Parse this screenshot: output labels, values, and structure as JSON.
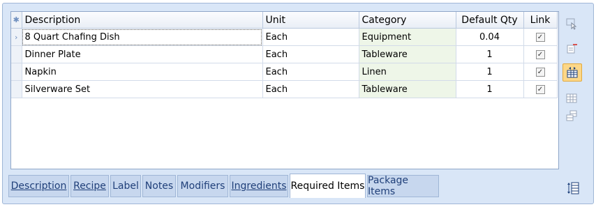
{
  "grid": {
    "columns": {
      "description": "Description",
      "unit": "Unit",
      "category": "Category",
      "default_qty": "Default Qty",
      "link": "Link"
    },
    "header_indicator": "✱",
    "row_indicator": "›",
    "rows": [
      {
        "description": "8 Quart Chafing Dish",
        "unit": "Each",
        "category": "Equipment",
        "default_qty": "0.04",
        "link_checked": "✓"
      },
      {
        "description": "Dinner Plate",
        "unit": "Each",
        "category": "Tableware",
        "default_qty": "1",
        "link_checked": "✓"
      },
      {
        "description": "Napkin",
        "unit": "Each",
        "category": "Linen",
        "default_qty": "1",
        "link_checked": "✓"
      },
      {
        "description": "Silverware Set",
        "unit": "Each",
        "category": "Tableware",
        "default_qty": "1",
        "link_checked": "✓"
      }
    ]
  },
  "side_toolbar": {
    "icons": [
      "select-row-icon",
      "remove-item-icon",
      "insert-column-icon",
      "grid-icon",
      "copy-grid-icon"
    ]
  },
  "tabs": [
    {
      "label": "Description"
    },
    {
      "label": "Recipe"
    },
    {
      "label": "Label"
    },
    {
      "label": "Notes"
    },
    {
      "label": "Modifiers"
    },
    {
      "label": "Ingredients"
    },
    {
      "label": "Required Items"
    },
    {
      "label": "Package Items"
    }
  ],
  "active_tab": "Required Items",
  "colors": {
    "frame_bg": "#d9e6f7",
    "category_cell_bg": "#eef6e8",
    "active_button_bg": "#fcd788"
  }
}
